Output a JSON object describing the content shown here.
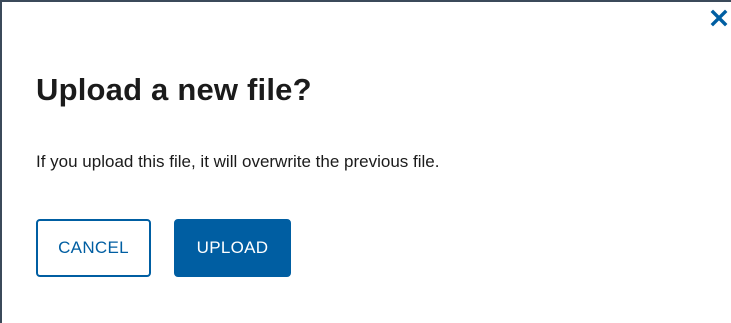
{
  "dialog": {
    "title": "Upload a new file?",
    "message": "If you upload this file, it will overwrite the previous file.",
    "close_icon": "close-icon",
    "buttons": {
      "cancel_label": "CANCEL",
      "upload_label": "UPLOAD"
    }
  },
  "colors": {
    "primary": "#005ea2",
    "text": "#1b1b1b",
    "border": "#3b4a5a",
    "background": "#ffffff"
  }
}
